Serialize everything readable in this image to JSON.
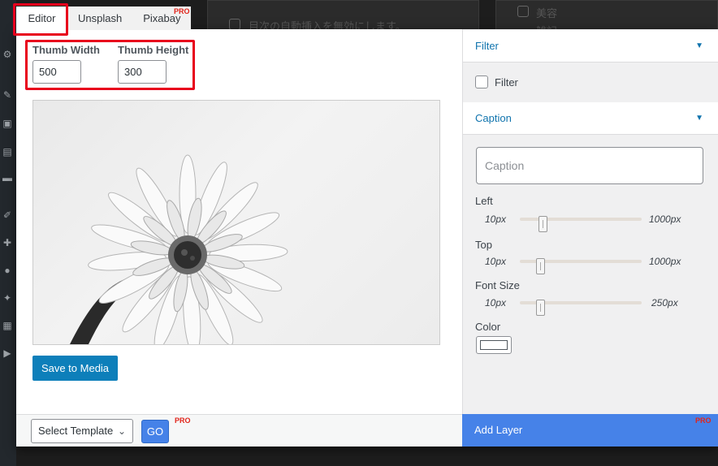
{
  "tabs": [
    {
      "label": "Editor",
      "active": true
    },
    {
      "label": "Unsplash",
      "active": false
    },
    {
      "label": "Pixabay",
      "active": false,
      "badge": "PRO"
    }
  ],
  "background": {
    "checkbox_text": "目次の自動挿入を無効にします。",
    "right_item_1": "美容",
    "right_item_2": "雑記"
  },
  "thumb": {
    "width_label": "Thumb Width",
    "width_value": "500",
    "height_label": "Thumb Height",
    "height_value": "300"
  },
  "editor": {
    "save_label": "Save to Media",
    "image_icon": "flower-photo"
  },
  "footer": {
    "template_selected": "Select Template",
    "go_label": "GO",
    "go_badge": "PRO"
  },
  "panel": {
    "filter_title": "Filter",
    "filter_checkbox_label": "Filter",
    "caption_title": "Caption",
    "caption_placeholder": "Caption",
    "left": {
      "label": "Left",
      "min": "10px",
      "max": "1000px",
      "value_fraction": 0.04
    },
    "top": {
      "label": "Top",
      "min": "10px",
      "max": "1000px",
      "value_fraction": 0.02
    },
    "font_size": {
      "label": "Font Size",
      "min": "10px",
      "max": "250px",
      "value_fraction": 0.02
    },
    "color": {
      "label": "Color",
      "value": "#ffffff"
    },
    "add_layer_label": "Add Layer",
    "add_layer_badge": "PRO"
  },
  "colors": {
    "accent_blue": "#4682e8",
    "save_blue": "#0d7fba",
    "link_blue": "#0f73ad",
    "highlight_red": "#e8001c",
    "pro_red": "#e1251b"
  }
}
